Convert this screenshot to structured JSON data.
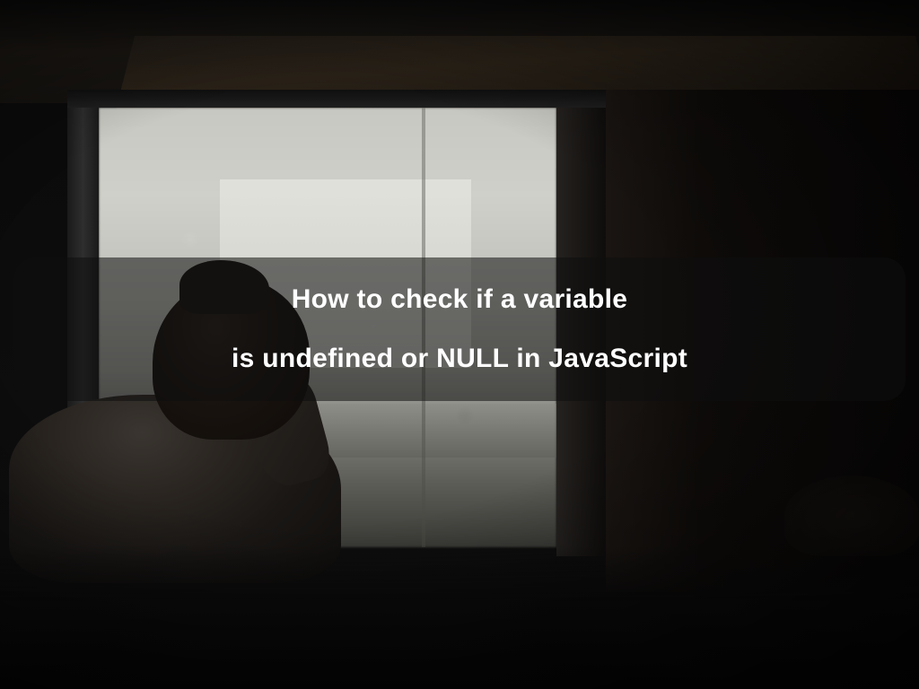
{
  "overlay": {
    "line1": "How to check if a variable",
    "line2": "is undefined or NULL in JavaScript"
  }
}
